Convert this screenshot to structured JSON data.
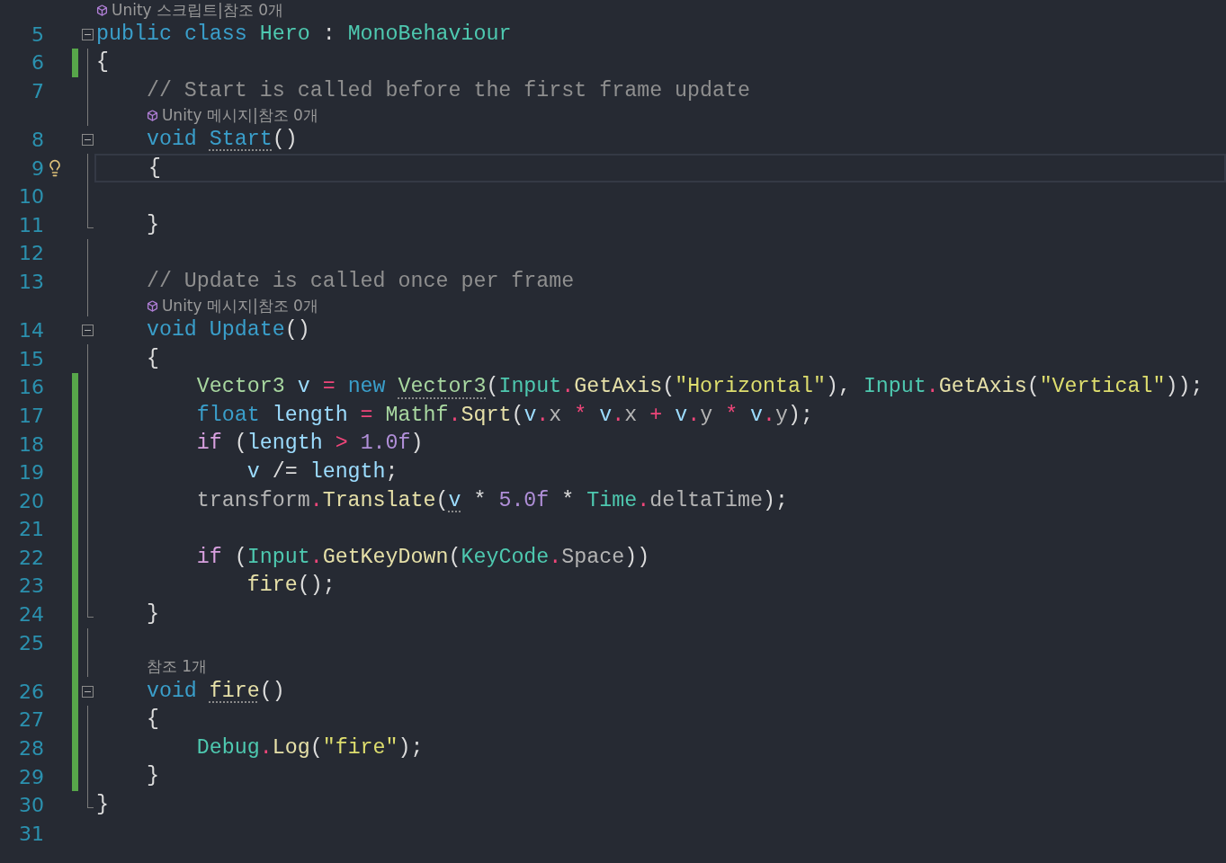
{
  "lines": [
    {
      "number": "5",
      "changed": false,
      "kind": "start",
      "current": false,
      "lightbulb": false,
      "lens": {
        "text": "Unity 스크립트|참조 0개",
        "unity": true
      },
      "tokens": [
        {
          "text": "public ",
          "kind": "keyword"
        },
        {
          "text": "class ",
          "kind": "keyword"
        },
        {
          "text": "Hero",
          "kind": "type"
        },
        {
          "text": " : ",
          "kind": "plain"
        },
        {
          "text": "MonoBehaviour",
          "kind": "type"
        }
      ]
    },
    {
      "number": "6",
      "changed": true,
      "kind": "body",
      "current": false,
      "lightbulb": false,
      "tokens": [
        {
          "text": "{",
          "kind": "plain"
        }
      ]
    },
    {
      "number": "7",
      "changed": false,
      "kind": "body",
      "current": false,
      "lightbulb": false,
      "tokens": [
        {
          "text": "    // Start is called before the first frame update",
          "kind": "comment"
        }
      ]
    },
    {
      "number": "8",
      "changed": false,
      "kind": "start",
      "current": false,
      "lightbulb": false,
      "lens": {
        "text": "Unity 메시지|참조 0개",
        "unity": true
      },
      "tokens": [
        {
          "text": "    void ",
          "kind": "keyword"
        },
        {
          "text": "Start",
          "kind": "keyword",
          "hint": true
        },
        {
          "text": "()",
          "kind": "plain"
        }
      ]
    },
    {
      "number": "9",
      "changed": false,
      "kind": "body",
      "current": true,
      "lightbulb": true,
      "tokens": [
        {
          "text": "    {",
          "kind": "plain"
        }
      ]
    },
    {
      "number": "10",
      "changed": false,
      "kind": "body",
      "current": false,
      "lightbulb": false
    },
    {
      "number": "11",
      "changed": false,
      "kind": "end",
      "current": false,
      "lightbulb": false,
      "tokens": [
        {
          "text": "    }",
          "kind": "plain"
        }
      ]
    },
    {
      "number": "12",
      "changed": false,
      "kind": "body",
      "current": false,
      "lightbulb": false
    },
    {
      "number": "13",
      "changed": false,
      "kind": "body",
      "current": false,
      "lightbulb": false,
      "tokens": [
        {
          "text": "    // Update is called once per frame",
          "kind": "comment"
        }
      ]
    },
    {
      "number": "14",
      "changed": false,
      "kind": "start",
      "current": false,
      "lightbulb": false,
      "lens": {
        "text": "Unity 메시지|참조 0개",
        "unity": true
      },
      "tokens": [
        {
          "text": "    void ",
          "kind": "keyword"
        },
        {
          "text": "Update",
          "kind": "keyword"
        },
        {
          "text": "()",
          "kind": "plain"
        }
      ]
    },
    {
      "number": "15",
      "changed": false,
      "kind": "body",
      "current": false,
      "lightbulb": false,
      "tokens": [
        {
          "text": "    {",
          "kind": "plain"
        }
      ]
    },
    {
      "number": "16",
      "changed": true,
      "kind": "body",
      "current": false,
      "lightbulb": false,
      "tokens": [
        {
          "text": "        Vector3 ",
          "kind": "struct"
        },
        {
          "text": "v ",
          "kind": "variable"
        },
        {
          "text": "= ",
          "kind": "operator"
        },
        {
          "text": "new ",
          "kind": "keyword"
        },
        {
          "text": "Vector3",
          "kind": "struct",
          "hint": true
        },
        {
          "text": "(",
          "kind": "plain"
        },
        {
          "text": "Input",
          "kind": "type"
        },
        {
          "text": ".",
          "kind": "operator"
        },
        {
          "text": "GetAxis",
          "kind": "method"
        },
        {
          "text": "(",
          "kind": "plain"
        },
        {
          "text": "\"Horizontal\"",
          "kind": "string"
        },
        {
          "text": "), ",
          "kind": "plain"
        },
        {
          "text": "Input",
          "kind": "type"
        },
        {
          "text": ".",
          "kind": "operator"
        },
        {
          "text": "GetAxis",
          "kind": "method"
        },
        {
          "text": "(",
          "kind": "plain"
        },
        {
          "text": "\"Vertical\"",
          "kind": "string"
        },
        {
          "text": "));",
          "kind": "plain"
        }
      ]
    },
    {
      "number": "17",
      "changed": true,
      "kind": "body",
      "current": false,
      "lightbulb": false,
      "tokens": [
        {
          "text": "        float ",
          "kind": "keyword"
        },
        {
          "text": "length ",
          "kind": "variable"
        },
        {
          "text": "= ",
          "kind": "operator"
        },
        {
          "text": "Mathf",
          "kind": "struct"
        },
        {
          "text": ".",
          "kind": "operator"
        },
        {
          "text": "Sqrt",
          "kind": "method"
        },
        {
          "text": "(",
          "kind": "plain"
        },
        {
          "text": "v",
          "kind": "variable"
        },
        {
          "text": ".",
          "kind": "operator"
        },
        {
          "text": "x ",
          "kind": "field"
        },
        {
          "text": "* ",
          "kind": "operator"
        },
        {
          "text": "v",
          "kind": "variable"
        },
        {
          "text": ".",
          "kind": "operator"
        },
        {
          "text": "x ",
          "kind": "field"
        },
        {
          "text": "+ ",
          "kind": "operator"
        },
        {
          "text": "v",
          "kind": "variable"
        },
        {
          "text": ".",
          "kind": "operator"
        },
        {
          "text": "y ",
          "kind": "field"
        },
        {
          "text": "* ",
          "kind": "operator"
        },
        {
          "text": "v",
          "kind": "variable"
        },
        {
          "text": ".",
          "kind": "operator"
        },
        {
          "text": "y",
          "kind": "field"
        },
        {
          "text": ");",
          "kind": "plain"
        }
      ]
    },
    {
      "number": "18",
      "changed": true,
      "kind": "body",
      "current": false,
      "lightbulb": false,
      "tokens": [
        {
          "text": "        if",
          "kind": "control"
        },
        {
          "text": " (",
          "kind": "plain"
        },
        {
          "text": "length ",
          "kind": "variable"
        },
        {
          "text": "> ",
          "kind": "operator"
        },
        {
          "text": "1.0f",
          "kind": "number"
        },
        {
          "text": ")",
          "kind": "plain"
        }
      ]
    },
    {
      "number": "19",
      "changed": true,
      "kind": "body",
      "current": false,
      "lightbulb": false,
      "tokens": [
        {
          "text": "            v",
          "kind": "variable"
        },
        {
          "text": " /= ",
          "kind": "plain"
        },
        {
          "text": "length",
          "kind": "variable"
        },
        {
          "text": ";",
          "kind": "plain"
        }
      ]
    },
    {
      "number": "20",
      "changed": true,
      "kind": "body",
      "current": false,
      "lightbulb": false,
      "tokens": [
        {
          "text": "        transform",
          "kind": "field"
        },
        {
          "text": ".",
          "kind": "operator"
        },
        {
          "text": "Translate",
          "kind": "method"
        },
        {
          "text": "(",
          "kind": "plain"
        },
        {
          "text": "v",
          "kind": "variable",
          "hint": true
        },
        {
          "text": " * ",
          "kind": "plain"
        },
        {
          "text": "5.0f",
          "kind": "number"
        },
        {
          "text": " * ",
          "kind": "plain"
        },
        {
          "text": "Time",
          "kind": "type"
        },
        {
          "text": ".",
          "kind": "operator"
        },
        {
          "text": "deltaTime",
          "kind": "field"
        },
        {
          "text": ");",
          "kind": "plain"
        }
      ]
    },
    {
      "number": "21",
      "changed": true,
      "kind": "body",
      "current": false,
      "lightbulb": false
    },
    {
      "number": "22",
      "changed": true,
      "kind": "body",
      "current": false,
      "lightbulb": false,
      "tokens": [
        {
          "text": "        if",
          "kind": "control"
        },
        {
          "text": " (",
          "kind": "plain"
        },
        {
          "text": "Input",
          "kind": "type"
        },
        {
          "text": ".",
          "kind": "operator"
        },
        {
          "text": "GetKeyDown",
          "kind": "method"
        },
        {
          "text": "(",
          "kind": "plain"
        },
        {
          "text": "KeyCode",
          "kind": "type"
        },
        {
          "text": ".",
          "kind": "operator"
        },
        {
          "text": "Space",
          "kind": "field"
        },
        {
          "text": "))",
          "kind": "plain"
        }
      ]
    },
    {
      "number": "23",
      "changed": true,
      "kind": "body",
      "current": false,
      "lightbulb": false,
      "tokens": [
        {
          "text": "            fire",
          "kind": "method"
        },
        {
          "text": "();",
          "kind": "plain"
        }
      ]
    },
    {
      "number": "24",
      "changed": true,
      "kind": "end",
      "current": false,
      "lightbulb": false,
      "tokens": [
        {
          "text": "    }",
          "kind": "plain"
        }
      ]
    },
    {
      "number": "25",
      "changed": true,
      "kind": "body",
      "current": false,
      "lightbulb": false
    },
    {
      "number": "26",
      "changed": true,
      "kind": "start",
      "current": false,
      "lightbulb": false,
      "lens": {
        "text": "참조 1개",
        "unity": false
      },
      "tokens": [
        {
          "text": "    void ",
          "kind": "keyword"
        },
        {
          "text": "fire",
          "kind": "method",
          "hint": true
        },
        {
          "text": "()",
          "kind": "plain"
        }
      ]
    },
    {
      "number": "27",
      "changed": true,
      "kind": "body",
      "current": false,
      "lightbulb": false,
      "tokens": [
        {
          "text": "    {",
          "kind": "plain"
        }
      ]
    },
    {
      "number": "28",
      "changed": true,
      "kind": "body",
      "current": false,
      "lightbulb": false,
      "tokens": [
        {
          "text": "        Debug",
          "kind": "type"
        },
        {
          "text": ".",
          "kind": "operator"
        },
        {
          "text": "Log",
          "kind": "method"
        },
        {
          "text": "(",
          "kind": "plain"
        },
        {
          "text": "\"fire\"",
          "kind": "string"
        },
        {
          "text": ");",
          "kind": "plain"
        }
      ]
    },
    {
      "number": "29",
      "changed": true,
      "kind": "body",
      "current": false,
      "lightbulb": false,
      "tokens": [
        {
          "text": "    }",
          "kind": "plain"
        }
      ]
    },
    {
      "number": "30",
      "changed": false,
      "kind": "end",
      "current": false,
      "lightbulb": false,
      "tokens": [
        {
          "text": "}",
          "kind": "plain"
        }
      ]
    },
    {
      "number": "31",
      "changed": false,
      "kind": "none",
      "current": false,
      "lightbulb": false
    }
  ]
}
